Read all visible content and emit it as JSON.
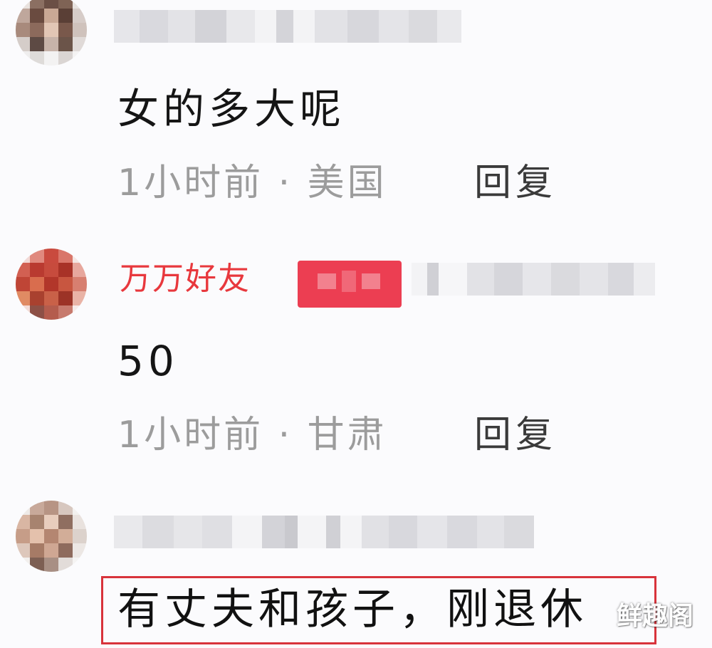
{
  "comments": [
    {
      "text": "女的多大呢",
      "meta": "1小时前 · 美国",
      "reply_label": "回复"
    },
    {
      "username": "万万好友",
      "text": "50",
      "meta": "1小时前 · 甘肃",
      "reply_label": "回复"
    },
    {
      "text": "有丈夫和孩子，刚退休"
    }
  ],
  "watermark": "鲜趣阁",
  "colors": {
    "username": "#e8383d",
    "badge": "#ec3e52",
    "highlight_border": "#d8333b",
    "meta": "#9c9c9c"
  }
}
